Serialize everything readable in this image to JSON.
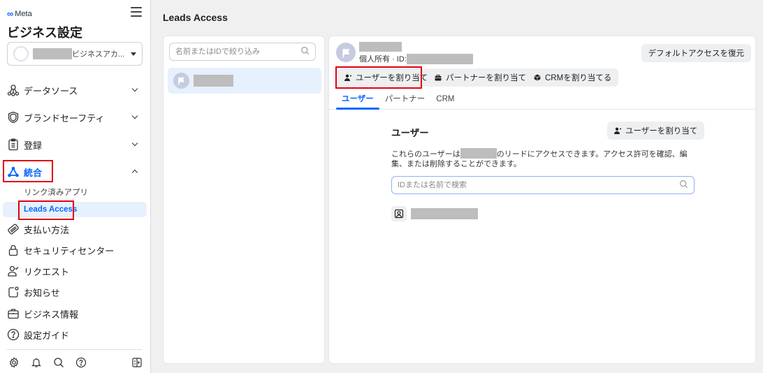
{
  "sidebar": {
    "brand": "Meta",
    "title": "ビジネス設定",
    "account": {
      "name_suffix": "ビジネスアカ..."
    },
    "items": [
      {
        "label": "データソース",
        "icon": "data-sources-icon",
        "expandable": true,
        "expanded": false
      },
      {
        "label": "ブランドセーフティ",
        "icon": "shield-icon",
        "expandable": true,
        "expanded": false
      },
      {
        "label": "登録",
        "icon": "clipboard-icon",
        "expandable": true,
        "expanded": false
      },
      {
        "label": "統合",
        "icon": "integrations-icon",
        "expandable": true,
        "expanded": true,
        "children": [
          {
            "label": "リンク済みアプリ",
            "active": false
          },
          {
            "label": "Leads Access",
            "active": true
          }
        ]
      },
      {
        "label": "支払い方法",
        "icon": "credit-card-icon"
      },
      {
        "label": "セキュリティセンター",
        "icon": "lock-icon"
      },
      {
        "label": "リクエスト",
        "icon": "person-check-icon"
      },
      {
        "label": "お知らせ",
        "icon": "notification-icon"
      },
      {
        "label": "ビジネス情報",
        "icon": "briefcase-icon"
      },
      {
        "label": "設定ガイド",
        "icon": "help-circle-icon"
      }
    ],
    "footer_icons": [
      "gear-icon",
      "bell-icon",
      "search-icon",
      "help-icon",
      "panel-toggle-icon"
    ]
  },
  "main": {
    "page_title": "Leads Access",
    "left_panel": {
      "filter_placeholder": "名前またはIDで絞り込み"
    },
    "detail": {
      "owner_label": "個人所有 · ID:",
      "restore_button": "デフォルトアクセスを復元",
      "actions": {
        "assign_user": "ユーザーを割り当て",
        "assign_partner": "パートナーを割り当て",
        "assign_crm": "CRMを割り当てる"
      },
      "tabs": [
        {
          "label": "ユーザー",
          "active": true
        },
        {
          "label": "パートナー",
          "active": false
        },
        {
          "label": "CRM",
          "active": false
        }
      ],
      "section": {
        "title": "ユーザー",
        "assign_button": "ユーザーを割り当て",
        "desc_before": "これらのユーザーは",
        "desc_after": "のリードにアクセスできます。アクセス許可を確認、編集、または削除することができます。",
        "search_placeholder": "IDまたは名前で検索"
      }
    }
  },
  "colors": {
    "accent": "#0866ff",
    "highlight_box": "#e0000f",
    "active_bg": "#e7f0fd"
  }
}
